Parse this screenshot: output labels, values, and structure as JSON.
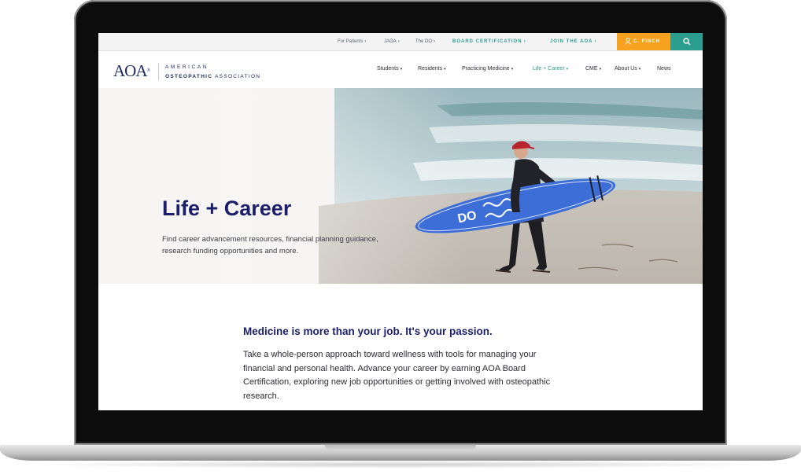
{
  "utility_nav": {
    "items": [
      {
        "label": "For Patients"
      },
      {
        "label": "JAOA"
      },
      {
        "label": "The DO"
      },
      {
        "label": "BOARD CERTIFICATION"
      },
      {
        "label": "JOIN THE AOA"
      }
    ],
    "caret": "›",
    "user_label": "C. FINCH",
    "user_icon": "user-icon",
    "search_icon": "search-icon"
  },
  "logo": {
    "mark": "AOA",
    "registered": "®",
    "line1": "AMERICAN",
    "line2_bold": "OSTEOPATHIC",
    "line2_rest": "ASSOCIATION"
  },
  "main_nav": {
    "items": [
      {
        "label": "Students"
      },
      {
        "label": "Residents"
      },
      {
        "label": "Practicing Medicine"
      },
      {
        "label": "Life + Career"
      },
      {
        "label": "CME"
      },
      {
        "label": "About Us"
      },
      {
        "label": "News"
      }
    ],
    "caret": "▾",
    "active_index": 3
  },
  "hero": {
    "title": "Life + Career",
    "description": "Find career advancement resources, financial planning guidance, research funding opportunities and more.",
    "board_text": "DO"
  },
  "content": {
    "heading": "Medicine is more than your job. It's your passion.",
    "body": "Take a whole-person approach toward wellness with tools for managing your financial and personal health. Advance your career by earning AOA Board Certification, exploring new job opportunities or getting involved with osteopathic research."
  },
  "colors": {
    "navy": "#1b1f6a",
    "teal": "#2a9d8f",
    "orange": "#f6a21e",
    "board_blue": "#3d6ed8"
  }
}
